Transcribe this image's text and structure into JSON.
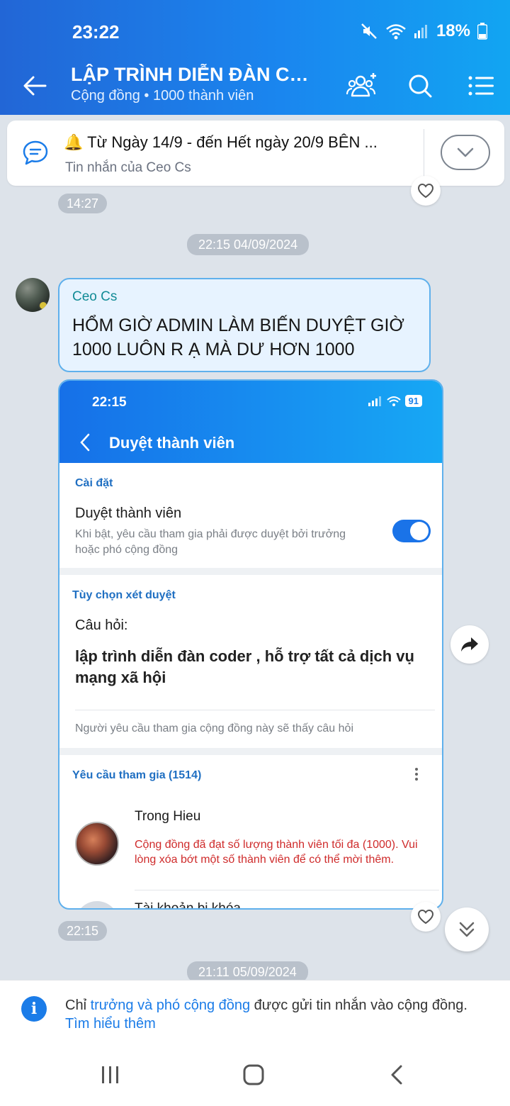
{
  "status_bar": {
    "time": "23:22",
    "battery": "18%"
  },
  "header": {
    "title": "LẬP TRÌNH DIỄN ĐÀN CO...",
    "subtitle": "Cộng đồng • 1000 thành viên"
  },
  "pinned": {
    "text": "🔔 Từ Ngày 14/9 - đến Hết ngày 20/9 BÊN ...",
    "sub": "Tin nhắn của Ceo Cs"
  },
  "messages": {
    "time_above": "14:27",
    "date_1": "22:15 04/09/2024",
    "sender": "Ceo Cs",
    "text": "HỔM GIỜ ADMIN LÀM BIẾN DUYỆT GIỜ 1000 LUÔN R Ạ MÀ DƯ HƠN 1000",
    "image_time": "22:15",
    "date_2": "21:11 05/09/2024"
  },
  "screenshot": {
    "time": "22:15",
    "battery": "91",
    "title": "Duyệt thành viên",
    "settings_label": "Cài đặt",
    "approve_title": "Duyệt thành viên",
    "approve_desc": "Khi bật, yêu cầu tham gia phải được duyệt bởi trưởng hoặc phó cộng đồng",
    "review_label": "Tùy chọn xét duyệt",
    "question_label": "Câu hỏi:",
    "question_text": "lập trình diễn đàn coder , hỗ trợ tất cả dịch vụ mạng xã hội",
    "question_note": "Người yêu cầu tham gia cộng đồng này sẽ thấy câu hỏi",
    "requests_label": "Yêu cầu tham gia (1514)",
    "request_name": "Trong Hieu",
    "request_error": "Cộng đồng đã đạt số lượng thành viên tối đa (1000). Vui lòng xóa bớt một số thành viên để có thể mời thêm.",
    "request_name_2": "Tài khoản bị khóa"
  },
  "notice": {
    "prefix": "Chỉ ",
    "highlight": "trưởng và phó cộng đồng",
    "suffix": " được gửi tin nhắn vào cộng đồng.",
    "link": "Tìm hiểu thêm"
  },
  "icons": [
    "back-arrow-icon",
    "add-member-icon",
    "search-icon",
    "menu-icon",
    "chat-icon",
    "chevron-down-icon",
    "heart-icon",
    "share-icon",
    "double-chevron-down-icon",
    "info-icon"
  ],
  "colors": {
    "accent": "#1b7ce8",
    "error": "#cf2b2b",
    "bubble": "#e7f3ff"
  }
}
